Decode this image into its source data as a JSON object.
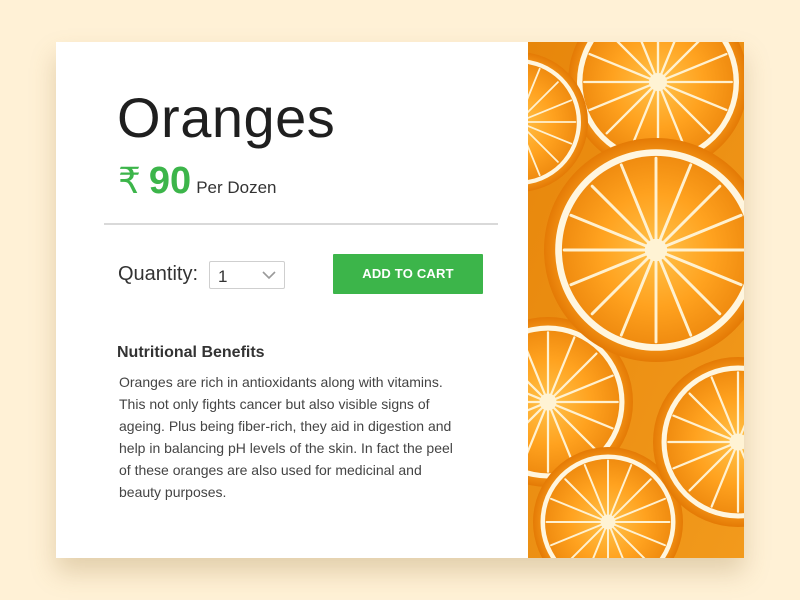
{
  "product": {
    "name": "Oranges",
    "currency_symbol": "₹",
    "price": "90",
    "unit": "Per Dozen"
  },
  "quantity": {
    "label": "Quantity:",
    "selected": "1"
  },
  "actions": {
    "add_to_cart": "ADD TO CART"
  },
  "nutrition": {
    "heading": "Nutritional Benefits",
    "lines": [
      "Oranges are rich in antioxidants along with vitamins.",
      "This not only fights cancer but also visible signs of",
      "ageing. Plus being fiber-rich, they aid in digestion and",
      "help in balancing pH levels of the skin. In fact the peel",
      "of these oranges are also used for medicinal and",
      "beauty purposes."
    ]
  },
  "image": {
    "subject": "sliced oranges photo"
  },
  "colors": {
    "background": "#fff1d6",
    "accent_green": "#3cb54a",
    "orange": "#f7941d"
  }
}
